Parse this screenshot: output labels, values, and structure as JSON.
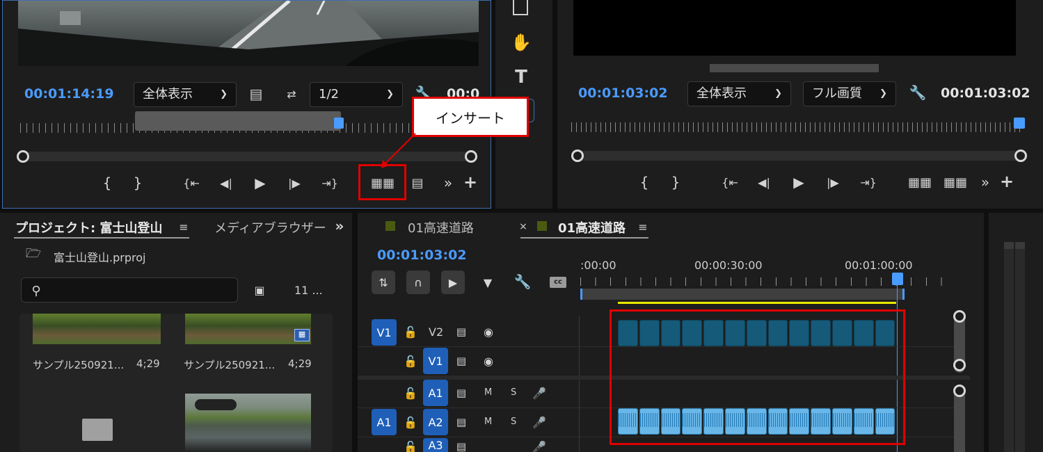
{
  "source": {
    "timecode": "00:01:14:19",
    "fit": "全体表示",
    "resolution": "1/2",
    "timecode_right": "00:0"
  },
  "program": {
    "timecode": "00:01:03:02",
    "fit": "全体表示",
    "quality": "フル画質",
    "duration": "00:01:03:02"
  },
  "callout": {
    "label": "インサート"
  },
  "project": {
    "tab": "プロジェクト: 富士山登山",
    "tab2": "メディアブラウザー",
    "file": "富士山登山.prproj",
    "search_placeholder": "",
    "count": "11 ...",
    "items": [
      {
        "name": "サンプル250921...",
        "dur": "4;29"
      },
      {
        "name": "サンプル250921...",
        "dur": "4;29"
      }
    ]
  },
  "timeline": {
    "tab1": "01高速道路",
    "tab2": "01高速道路",
    "timecode": "00:01:03:02",
    "ruler": [
      ":00:00",
      "00:00:30:00",
      "00:01:00:00"
    ],
    "tracks": {
      "v_src": "V1",
      "v2": "V2",
      "v1": "V1",
      "a_src": "A1",
      "a1": "A1",
      "a2": "A2",
      "a3": "A3",
      "m": "M",
      "s": "S"
    }
  },
  "colors": {
    "accent": "#4a9bff",
    "video_clip": "#155a78",
    "audio_clip": "#69b6e8",
    "highlight": "#e00000"
  }
}
